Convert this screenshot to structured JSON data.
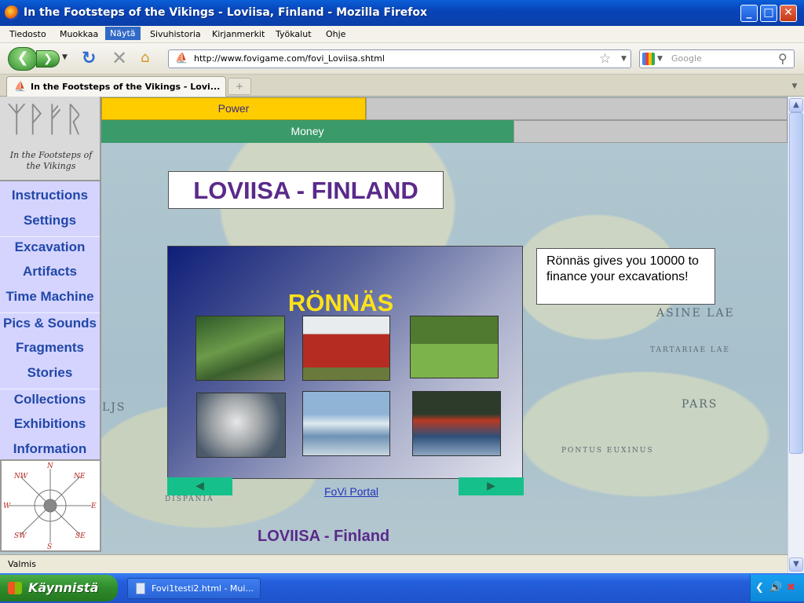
{
  "window": {
    "title": "In the Footsteps of the Vikings - Loviisa, Finland - Mozilla Firefox"
  },
  "menu": [
    "Tiedosto",
    "Muokkaa",
    "Näytä",
    "Sivuhistoria",
    "Kirjanmerkit",
    "Työkalut",
    "Ohje"
  ],
  "menu_active": "Näytä",
  "nav": {
    "url": "http://www.fovigame.com/fovi_Loviisa.shtml",
    "search_placeholder": "Google"
  },
  "tab": {
    "label": "In the Footsteps of the Vikings - Lovi..."
  },
  "logo": {
    "caption": "In the Footsteps of the Vikings"
  },
  "bars": {
    "power_label": "Power",
    "money_label": "Money"
  },
  "sidebar": {
    "items": [
      "Instructions",
      "Settings",
      "Excavation",
      "Artifacts",
      "Time Machine",
      "Pics & Sounds",
      "Fragments",
      "Stories",
      "Collections",
      "Exhibitions",
      "Information"
    ]
  },
  "compass": {
    "n": "N",
    "ne": "NE",
    "e": "E",
    "se": "SE",
    "s": "S",
    "sw": "SW",
    "w": "W",
    "nw": "NW"
  },
  "main": {
    "title": "LOVIISA - FINLAND",
    "panel_title": "RÖNNÄS",
    "info_text": "Rönnäs gives you 10000 to finance your excavations!",
    "portal_link": "FoVi Portal",
    "footer_title": "LOVIISA - Finland",
    "prev_arrow": "◀",
    "next_arrow": "▶"
  },
  "map_labels": [
    "ASINE LAE",
    "PARS",
    "LJS",
    "TARTARIAE LAE",
    "PONTUS EUXINUS",
    "DISPANIA"
  ],
  "status": {
    "text": "Valmis"
  },
  "taskbar": {
    "start_label": "Käynnistä",
    "task_label": "Fovi1testi2.html - Mui..."
  },
  "colors": {
    "power": "#ffcc00",
    "money": "#3a9a6a",
    "nav_text": "#2147a8",
    "title_purple": "#5a2a8a",
    "panel_title": "#ffe11a"
  }
}
